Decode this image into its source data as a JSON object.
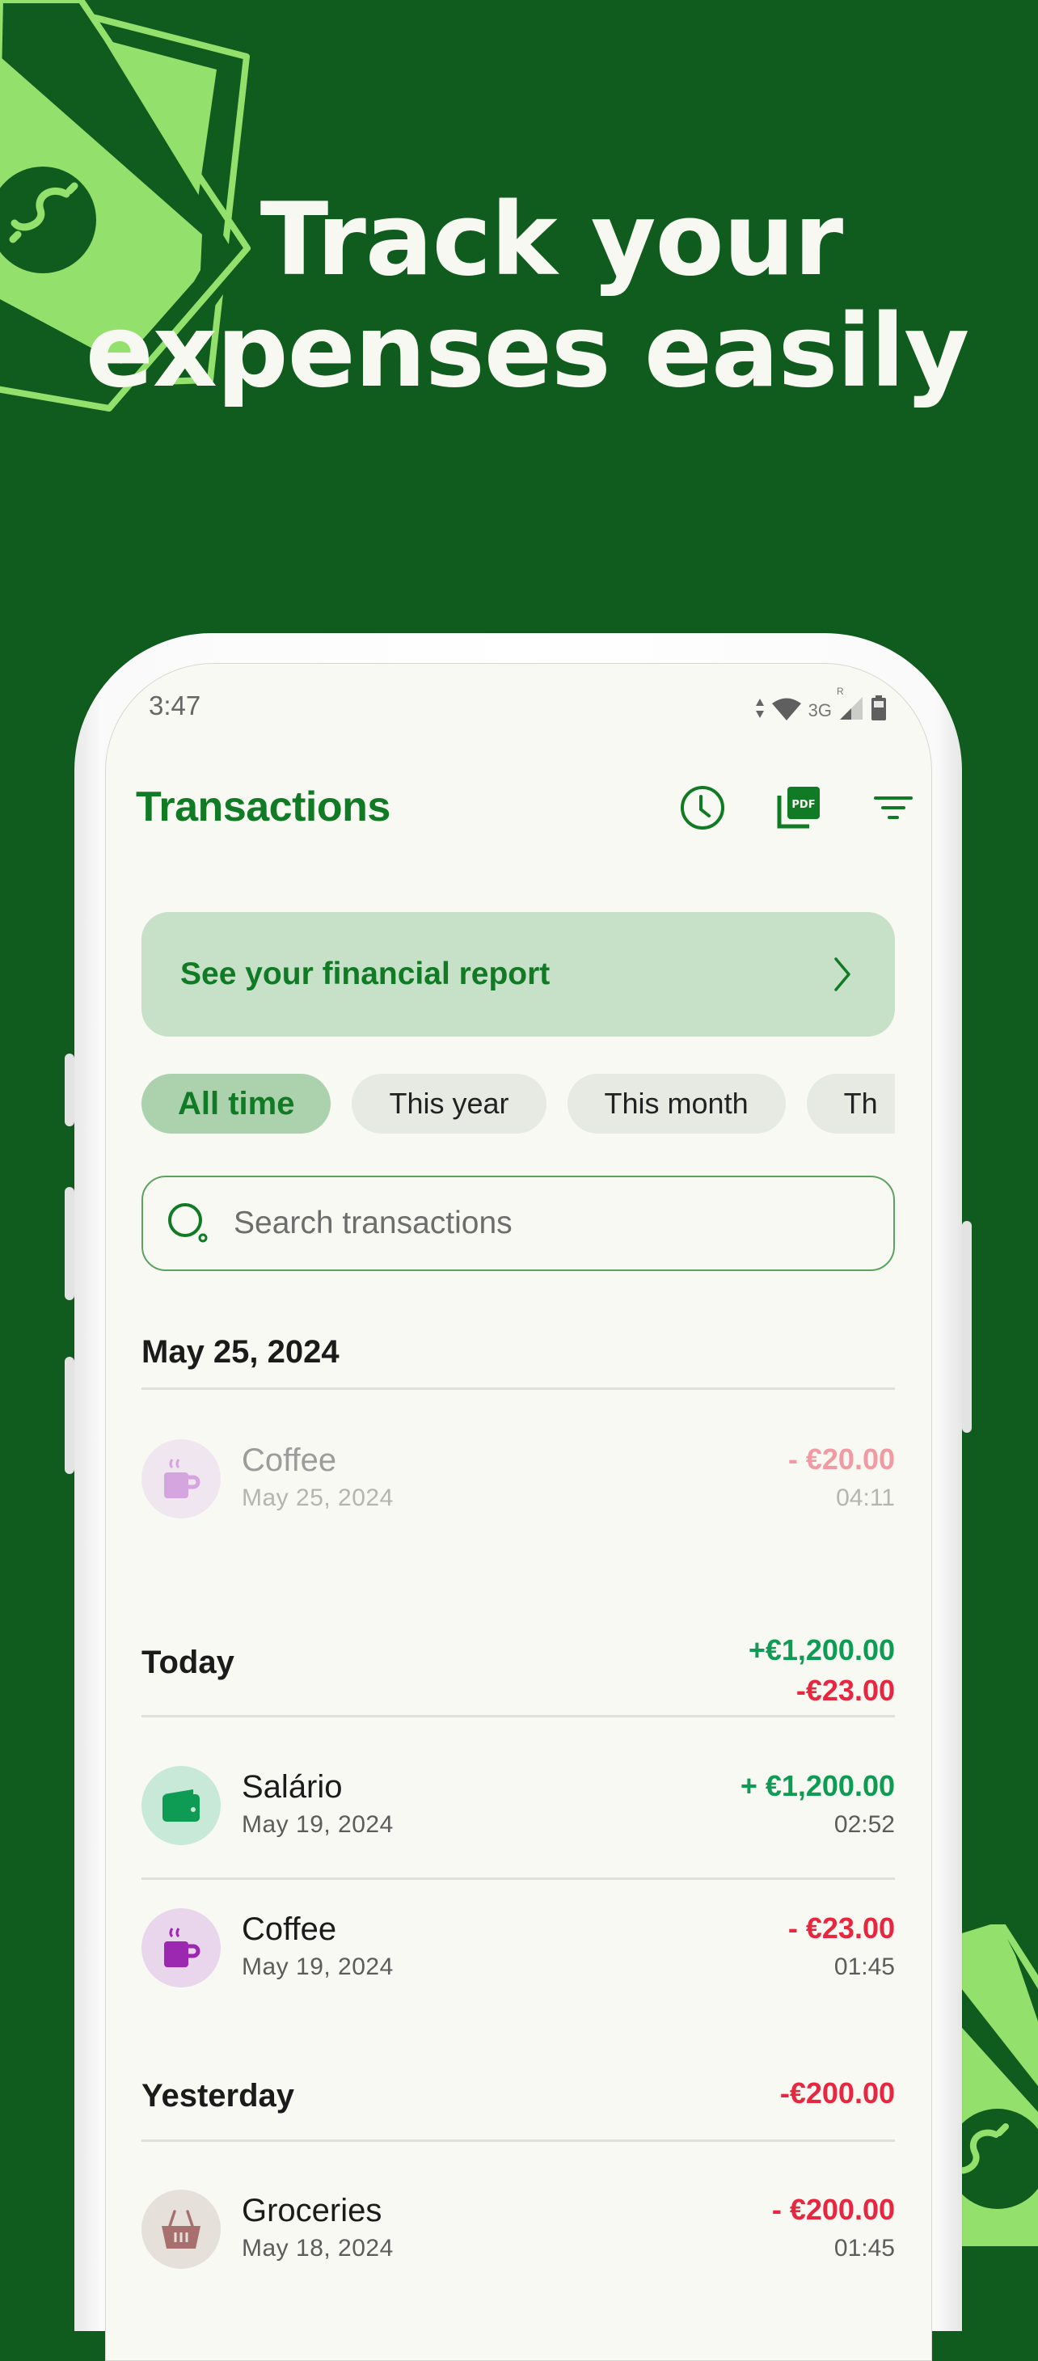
{
  "headline": {
    "line1": "Track your",
    "line2": "expenses easily"
  },
  "status_bar": {
    "time": "3:47",
    "network": "3G",
    "roaming": "R"
  },
  "app_bar": {
    "title": "Transactions",
    "actions": [
      "history-clock",
      "export-pdf",
      "filter"
    ]
  },
  "report_card": {
    "label": "See your financial report"
  },
  "period_chips": [
    {
      "label": "All time",
      "selected": true
    },
    {
      "label": "This year",
      "selected": false
    },
    {
      "label": "This month",
      "selected": false
    },
    {
      "label": "Th",
      "selected": false
    }
  ],
  "search": {
    "placeholder": "Search transactions",
    "value": ""
  },
  "colors": {
    "brand_green": "#117a24",
    "background": "#0f5c1e",
    "income": "#0e9c55",
    "expense": "#e8263f"
  },
  "groups": [
    {
      "title": "May 25, 2024",
      "income_total": "",
      "expense_total": "",
      "transactions": [
        {
          "name": "Coffee",
          "date": "May 25, 2024",
          "amount": "- €20.00",
          "time": "04:11",
          "category_icon": "coffee-cup",
          "type": "expense",
          "faded": true
        }
      ]
    },
    {
      "title": "Today",
      "income_total": "+€1,200.00",
      "expense_total": "-€23.00",
      "transactions": [
        {
          "name": "Salário",
          "date": "May 19, 2024",
          "amount": "+ €1,200.00",
          "time": "02:52",
          "category_icon": "wallet",
          "type": "income",
          "faded": false
        },
        {
          "name": "Coffee",
          "date": "May 19, 2024",
          "amount": "- €23.00",
          "time": "01:45",
          "category_icon": "coffee-cup",
          "type": "expense",
          "faded": false
        }
      ]
    },
    {
      "title": "Yesterday",
      "income_total": "",
      "expense_total": "-€200.00",
      "transactions": [
        {
          "name": "Groceries",
          "date": "May 18, 2024",
          "amount": "- €200.00",
          "time": "01:45",
          "category_icon": "shopping-basket",
          "type": "expense",
          "faded": false
        }
      ]
    }
  ]
}
